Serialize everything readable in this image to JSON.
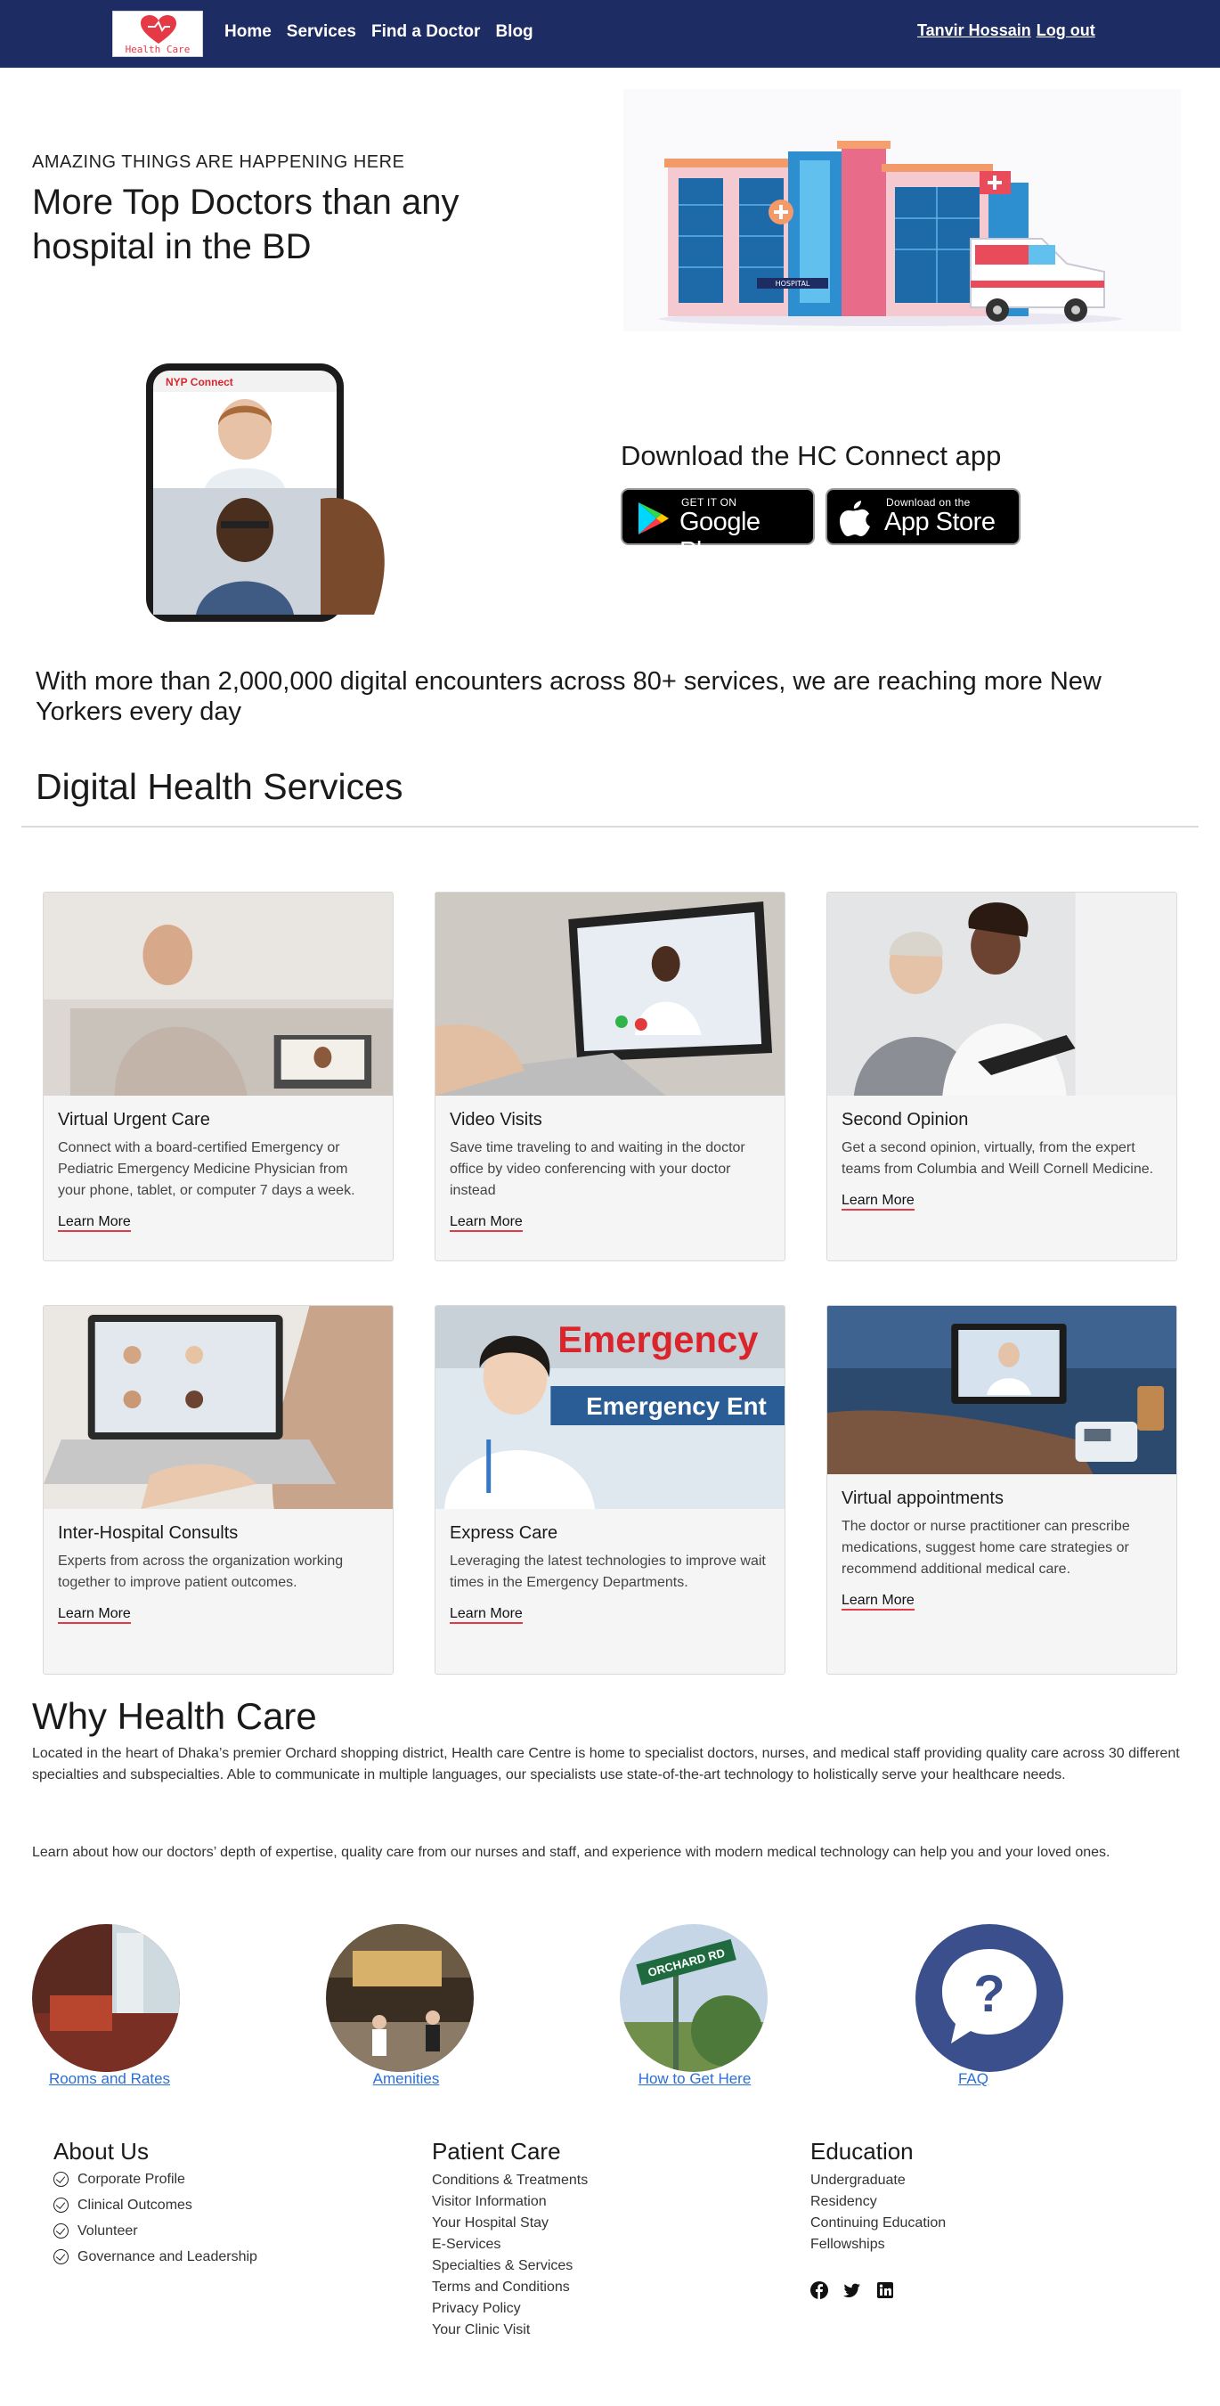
{
  "nav": {
    "logo_text": "Health Care",
    "links": [
      "Home",
      "Services",
      "Find a Doctor",
      "Blog"
    ],
    "user_name": "Tanvir Hossain",
    "logout_label": "Log out"
  },
  "hero": {
    "tagline": "AMAZING THINGS ARE HAPPENING HERE",
    "title": "More Top Doctors than any hospital in the BD",
    "illustration_sign": "HOSPITAL"
  },
  "app": {
    "title": "Download the HC Connect app",
    "phone_header": "NYP Connect",
    "google_small": "GET IT ON",
    "google_big": "Google Play",
    "apple_small": "Download on the",
    "apple_big": "App Store"
  },
  "stats_text": "With more than 2,000,000 digital encounters across 80+ services, we are reaching more New Yorkers every day",
  "services_title": "Digital Health Services",
  "cards": [
    {
      "title": "Virtual Urgent Care",
      "text": "Connect with a board-certified Emergency or Pediatric Emergency Medicine Physician from your phone, tablet, or computer 7 days a week.",
      "link": "Learn More"
    },
    {
      "title": "Video Visits",
      "text": "Save time traveling to and waiting in the doctor office by video conferencing with your doctor instead",
      "link": "Learn More"
    },
    {
      "title": "Second Opinion",
      "text": "Get a second opinion, virtually, from the expert teams from Columbia and Weill Cornell Medicine.",
      "link": "Learn More"
    },
    {
      "title": "Inter-Hospital Consults",
      "text": "Experts from across the organization working together to improve patient outcomes.",
      "link": "Learn More"
    },
    {
      "title": "Express Care",
      "text": "Leveraging the latest technologies to improve wait times in the Emergency Departments.",
      "link": "Learn More"
    },
    {
      "title": "Virtual appointments",
      "text": "The doctor or nurse practitioner can prescribe medications, suggest home care strategies or recommend additional medical care.",
      "link": "Learn More"
    }
  ],
  "express_img": {
    "sign1": "Emergency",
    "sign2": "Emergency Ent"
  },
  "why": {
    "title": "Why Health Care",
    "p1": "Located in the heart of Dhaka’s premier Orchard shopping district, Health care Centre is home to specialist doctors, nurses, and medical staff providing quality care across 30 different specialties and subspecialties. Able to communicate in multiple languages, our specialists use state-of-the-art technology to holistically serve your healthcare needs.",
    "p2": "Learn about how our doctors’ depth of expertise, quality care from our nurses and staff, and experience with modern medical technology can help you and your loved ones."
  },
  "circles": [
    {
      "label": "Rooms and Rates"
    },
    {
      "label": "Amenities"
    },
    {
      "label": "How to Get Here",
      "sign": "ORCHARD RD"
    },
    {
      "label": "FAQ"
    }
  ],
  "footer": {
    "about": {
      "title": "About Us",
      "items": [
        "Corporate Profile",
        "Clinical Outcomes",
        "Volunteer",
        "Governance and Leadership"
      ]
    },
    "patient": {
      "title": "Patient Care",
      "items": [
        "Conditions & Treatments",
        "Visitor Information",
        "Your Hospital Stay",
        "E-Services",
        "Specialties & Services",
        "Terms and Conditions",
        "Privacy Policy",
        "Your Clinic Visit"
      ]
    },
    "education": {
      "title": "Education",
      "items": [
        "Undergraduate",
        "Residency",
        "Continuing Education",
        "Fellowships"
      ]
    }
  },
  "colors": {
    "nav_bg": "#1d2c63",
    "accent_red": "#e63946",
    "link_blue": "#2b6fd6",
    "faq_bg": "#3a4f8c"
  },
  "icons": [
    "heart-logo-icon",
    "google-play-icon",
    "apple-icon",
    "check-circle-icon",
    "facebook-icon",
    "twitter-icon",
    "linkedin-icon",
    "question-icon"
  ]
}
